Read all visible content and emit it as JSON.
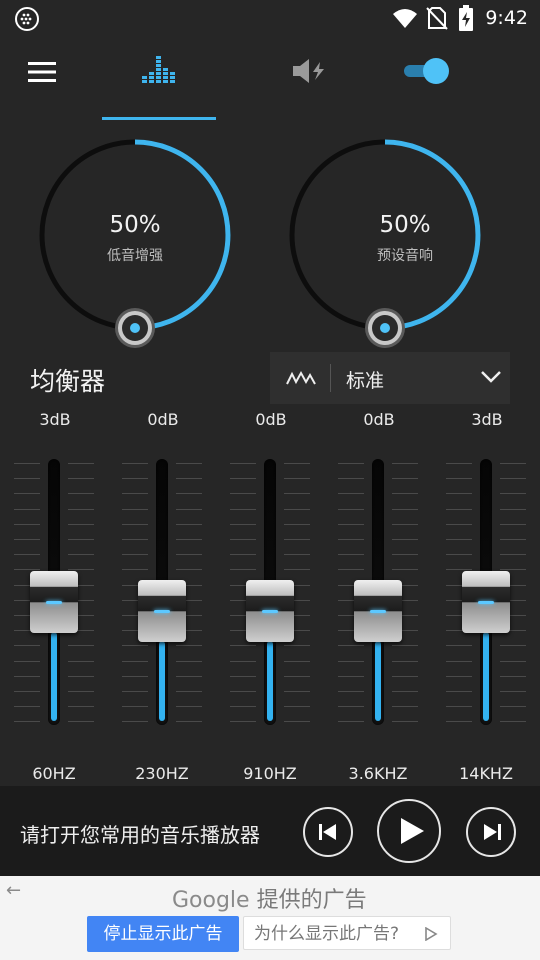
{
  "status_bar": {
    "time": "9:42"
  },
  "knobs": [
    {
      "value_text": "50%",
      "label": "低音增强",
      "level": 0.5
    },
    {
      "value_text": "50%",
      "label": "预设音响",
      "level": 0.5
    }
  ],
  "equalizer": {
    "title": "均衡器",
    "preset": "标准",
    "bands": [
      {
        "db": "3dB",
        "freq": "60HZ",
        "gain_db": 3
      },
      {
        "db": "0dB",
        "freq": "230HZ",
        "gain_db": 0
      },
      {
        "db": "0dB",
        "freq": "910HZ",
        "gain_db": 0
      },
      {
        "db": "0dB",
        "freq": "3.6KHZ",
        "gain_db": 0
      },
      {
        "db": "3dB",
        "freq": "14KHZ",
        "gain_db": 3
      }
    ]
  },
  "player": {
    "message": "请打开您常用的音乐播放器"
  },
  "ad": {
    "brand": "Google",
    "provided_by": "提供的广告",
    "stop_button": "停止显示此广告",
    "why_button": "为什么显示此广告?"
  },
  "colors": {
    "accent": "#3fb5ee",
    "background": "#262626",
    "ad_button": "#4285f4"
  }
}
